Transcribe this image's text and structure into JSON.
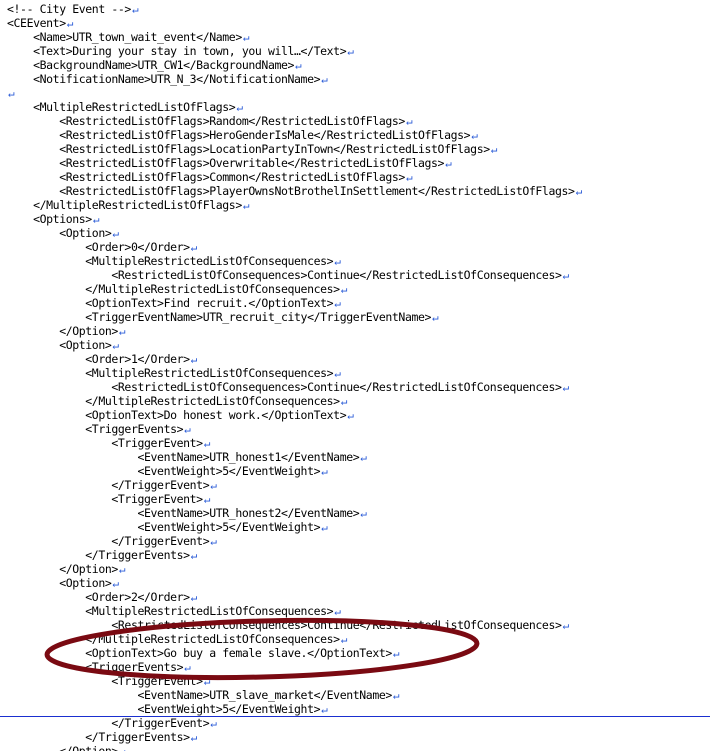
{
  "editor": {
    "eol_marker": "↵",
    "lines": [
      "<!-- City Event -->",
      "<CEEvent>",
      "    <Name>UTR_town_wait_event</Name>",
      "    <Text>During your stay in town, you will…</Text>",
      "    <BackgroundName>UTR_CW1</BackgroundName>",
      "    <NotificationName>UTR_N_3</NotificationName>",
      "",
      "    <MultipleRestrictedListOfFlags>",
      "        <RestrictedListOfFlags>Random</RestrictedListOfFlags>",
      "        <RestrictedListOfFlags>HeroGenderIsMale</RestrictedListOfFlags>",
      "        <RestrictedListOfFlags>LocationPartyInTown</RestrictedListOfFlags>",
      "        <RestrictedListOfFlags>Overwritable</RestrictedListOfFlags>",
      "        <RestrictedListOfFlags>Common</RestrictedListOfFlags>",
      "        <RestrictedListOfFlags>PlayerOwnsNotBrothelInSettlement</RestrictedListOfFlags>",
      "    </MultipleRestrictedListOfFlags>",
      "    <Options>",
      "        <Option>",
      "            <Order>0</Order>",
      "            <MultipleRestrictedListOfConsequences>",
      "                <RestrictedListOfConsequences>Continue</RestrictedListOfConsequences>",
      "            </MultipleRestrictedListOfConsequences>",
      "            <OptionText>Find recruit.</OptionText>",
      "            <TriggerEventName>UTR_recruit_city</TriggerEventName>",
      "        </Option>",
      "        <Option>",
      "            <Order>1</Order>",
      "            <MultipleRestrictedListOfConsequences>",
      "                <RestrictedListOfConsequences>Continue</RestrictedListOfConsequences>",
      "            </MultipleRestrictedListOfConsequences>",
      "            <OptionText>Do honest work.</OptionText>",
      "            <TriggerEvents>",
      "                <TriggerEvent>",
      "                    <EventName>UTR_honest1</EventName>",
      "                    <EventWeight>5</EventWeight>",
      "                </TriggerEvent>",
      "                <TriggerEvent>",
      "                    <EventName>UTR_honest2</EventName>",
      "                    <EventWeight>5</EventWeight>",
      "                </TriggerEvent>",
      "            </TriggerEvents>",
      "        </Option>",
      "        <Option>",
      "            <Order>2</Order>",
      "            <MultipleRestrictedListOfConsequences>",
      "                <RestrictedListOfConsequences>Continue</RestrictedListOfConsequences>",
      "            </MultipleRestrictedListOfConsequences>",
      "            <OptionText>Go buy a female slave.</OptionText>",
      "            <TriggerEvents>",
      "                <TriggerEvent>",
      "                    <EventName>UTR_slave_market</EventName>",
      "                    <EventWeight>5</EventWeight>",
      "                </TriggerEvent>",
      "            </TriggerEvents>",
      "        </Option>"
    ]
  },
  "annotation": {
    "color": "#7a0a12",
    "shape": "ellipse"
  },
  "colors": {
    "background": "#ffffff",
    "text": "#000000",
    "eol_marker": "#2a5bd7",
    "rule": "#1a2fd0"
  }
}
